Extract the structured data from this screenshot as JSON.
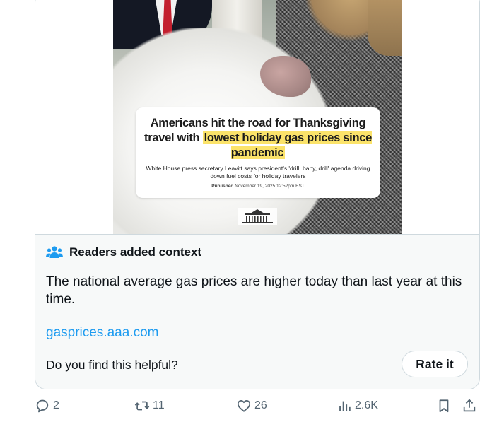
{
  "media": {
    "headline_part1": "Americans hit the road for Thanksgiving travel with ",
    "headline_highlight": "lowest holiday gas prices since pandemic",
    "subhead": "White House press secretary Leavitt says president's 'drill, baby, drill' agenda driving down fuel costs for holiday travelers",
    "published_label": "Published",
    "published_date": "November 19, 2025 12:52pm EST"
  },
  "context": {
    "title": "Readers added context",
    "body": "The national average gas prices are higher today than last year at this time.",
    "link": "gasprices.aaa.com",
    "question": "Do you find this helpful?",
    "rate_label": "Rate it"
  },
  "actions": {
    "replies": "2",
    "reposts": "11",
    "likes": "26",
    "views": "2.6K"
  },
  "colors": {
    "accent": "#1d9bf0",
    "highlight": "#fbe36a",
    "muted": "#536471",
    "border": "#cfd9de"
  }
}
